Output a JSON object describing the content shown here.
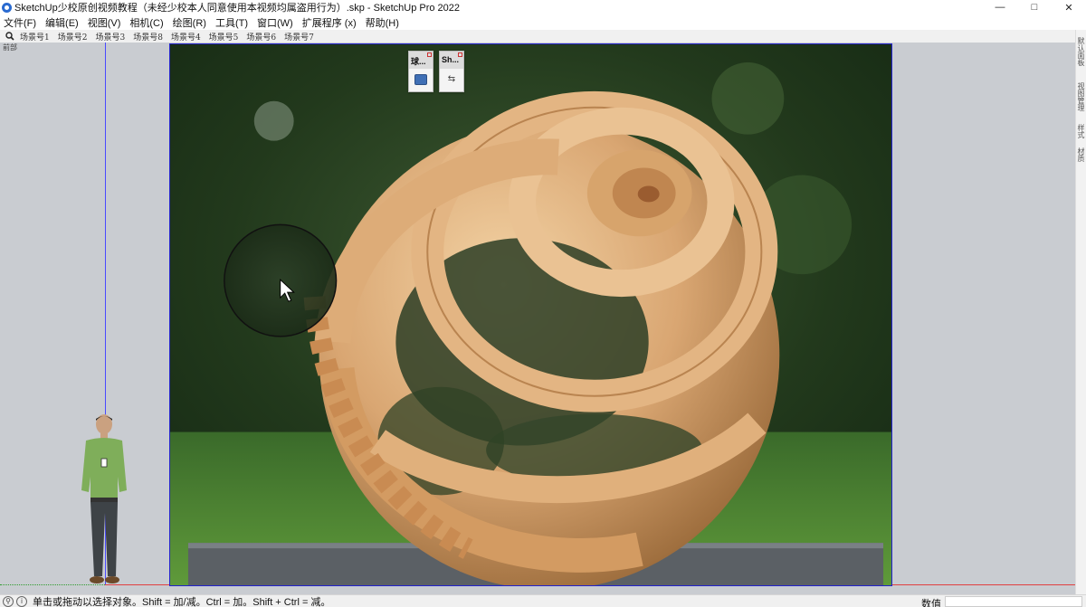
{
  "window": {
    "title": "SketchUp少校原创视频教程（未经少校本人同意使用本视频均属盗用行为）.skp - SketchUp Pro 2022",
    "controls": {
      "minimize": "—",
      "maximize": "□",
      "close": "✕"
    }
  },
  "menubar": {
    "items": [
      "文件(F)",
      "编辑(E)",
      "视图(V)",
      "相机(C)",
      "绘图(R)",
      "工具(T)",
      "窗口(W)",
      "扩展程序 (x)",
      "帮助(H)"
    ]
  },
  "scenes": {
    "search_icon": "search-icon",
    "tabs": [
      "场景号1",
      "场景号2",
      "场景号3",
      "场景号8",
      "场景号4",
      "场景号5",
      "场景号6",
      "场景号7"
    ]
  },
  "viewport": {
    "view_label": "前部"
  },
  "floating_toolbars": [
    {
      "title": "球...",
      "button_icon": "blue-square-icon"
    },
    {
      "title": "Sh...",
      "button_icon": "swap-icon"
    }
  ],
  "tray": {
    "items": [
      "默认面板",
      "视图管理",
      "样式",
      "材质"
    ]
  },
  "statusbar": {
    "text": "单击或拖动以选择对象。Shift = 加/减。Ctrl = 加。Shift + Ctrl = 减。",
    "measurements_label": "数值",
    "measurements_value": ""
  },
  "colors": {
    "axis_blue": "#4a4aff",
    "axis_red": "#e04040",
    "axis_green": "#2e9b2e",
    "viewport_bg": "#c9ccd1"
  }
}
